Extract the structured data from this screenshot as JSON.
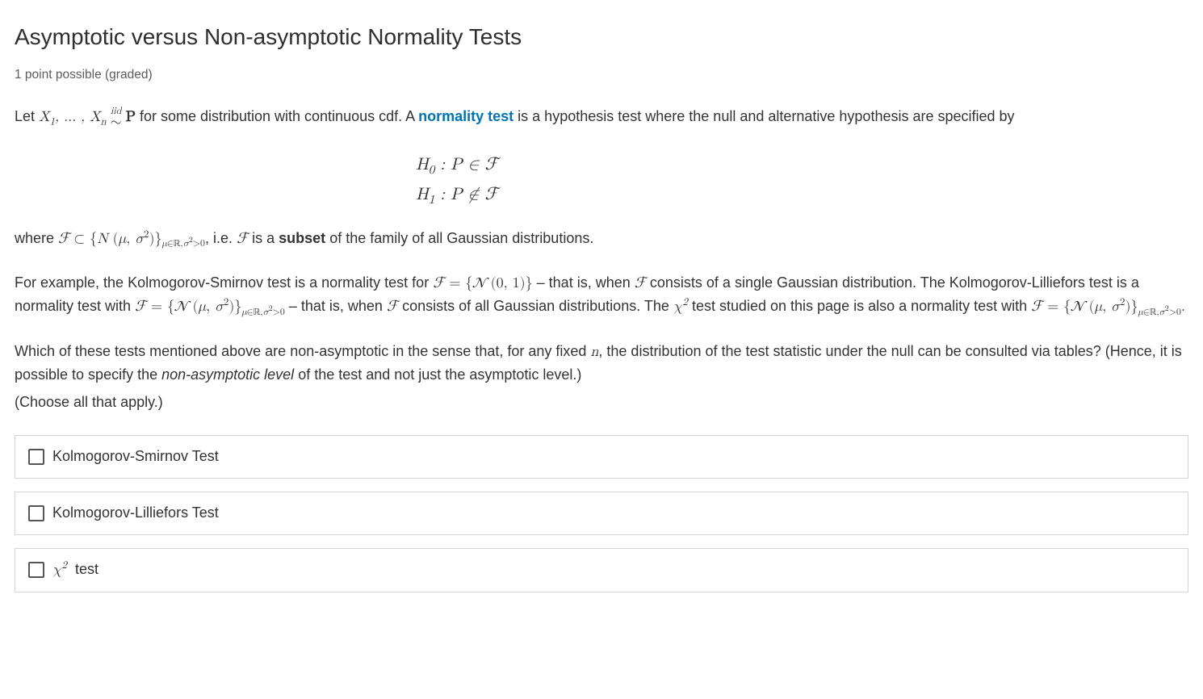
{
  "title": "Asymptotic versus Non-asymptotic Normality Tests",
  "meta": "1 point possible (graded)",
  "intro": {
    "let": "Let ",
    "iid_top": "iid",
    "iid_bot": "∼",
    "p_bold": "P",
    "after_p": " for some distribution with continuous cdf. A ",
    "term_link": "normality test",
    "after_link": " is a hypothesis test where the null and alternative hypothesis are specified by"
  },
  "hypothesis": {
    "h0": "H₀ : P ∈ ℱ",
    "h1": "H₁ : P ∉ ℱ"
  },
  "where": {
    "pre": "where ",
    "ie": ", i.e. ",
    "post": " is a ",
    "bold_subset": "subset",
    "tail": " of the family of all Gaussian distributions."
  },
  "example": {
    "p1a": "For example, the Kolmogorov-Smirnov test is a normality test for ",
    "p1b": " – that is, when ",
    "p1c": " consists of a single Gaussian distribution. The Kolmogorov-Lilliefors test is a normality test with ",
    "p1d": " – that is, when ",
    "p1e": " consists of all Gaussian distributions. The ",
    "p1f": " test studied on this page is also a normality test with ",
    "p1g": "."
  },
  "question": {
    "line1a": "Which of these tests mentioned above are non-asymptotic in the sense that, for any fixed ",
    "n_var": "n",
    "line1b": ", the distribution of the test statistic under the null can be consulted via tables? (Hence, it is possible to specify the ",
    "ital": "non-asymptotic level",
    "line1c": " of the test and not just the asymptotic level.)",
    "line2": "(Choose all that apply.)"
  },
  "choices": [
    {
      "label": "Kolmogorov-Smirnov Test"
    },
    {
      "label": "Kolmogorov-Lilliefors Test"
    },
    {
      "label_math": "χ²  test"
    }
  ]
}
